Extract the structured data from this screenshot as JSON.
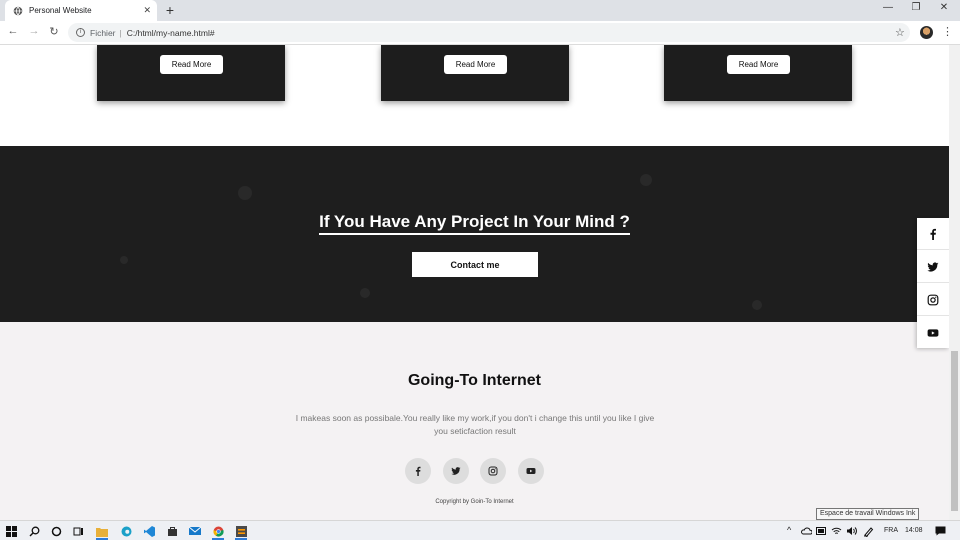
{
  "browser": {
    "tab_title": "Personal Website",
    "tab_close": "✕",
    "new_tab": "+",
    "win_min": "—",
    "win_restore": "❐",
    "win_close": "✕",
    "back": "←",
    "forward": "→",
    "reload": "↻",
    "url_scheme": "Fichier",
    "url_separator": "|",
    "url": "C:/html/my-name.html#",
    "bookmark": "☆",
    "menu": "⋮"
  },
  "cards": [
    {
      "button": "Read More"
    },
    {
      "button": "Read More"
    },
    {
      "button": "Read More"
    }
  ],
  "project": {
    "title": "If You Have Any Project In Your Mind ?",
    "button": "Contact me"
  },
  "footer": {
    "title": "Going-To Internet",
    "text": "I makeas soon as possibale.You really like my work,if you don't i change this until you like I give you seticfaction result",
    "social": [
      "facebook-icon",
      "twitter-icon",
      "instagram-icon",
      "youtube-icon"
    ],
    "copyright": "Copyright by Goin-To Internet"
  },
  "side_social": [
    "facebook-icon",
    "twitter-icon",
    "instagram-icon",
    "youtube-icon"
  ],
  "tooltip": "Espace de travail Windows Ink",
  "taskbar": {
    "lang": "FRA",
    "time": "14:08"
  },
  "colors": {
    "dark_section": "#1e1e1e",
    "footer_bg": "#f4f2f3",
    "accent_taskbar": "#2d7bd8"
  }
}
